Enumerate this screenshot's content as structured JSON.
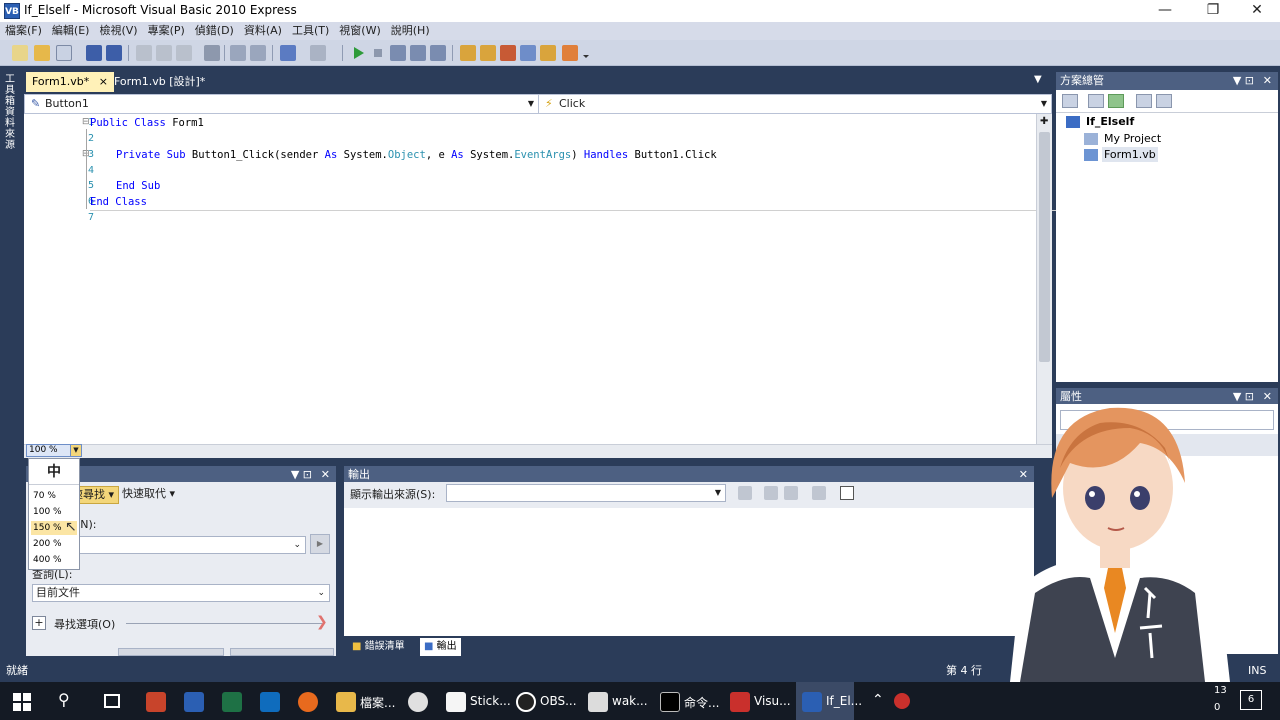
{
  "window": {
    "title": "If_Elself - Microsoft Visual Basic 2010 Express",
    "app_icon_text": "VB"
  },
  "menu": [
    "檔案(F)",
    "編輯(E)",
    "檢視(V)",
    "專案(P)",
    "偵錯(D)",
    "資料(A)",
    "工具(T)",
    "視窗(W)",
    "說明(H)"
  ],
  "left_strip": {
    "label": "工具箱資料來源"
  },
  "doc_tabs": [
    {
      "label": "Form1.vb*",
      "active": true,
      "close": "×"
    },
    {
      "label": "Form1.vb [設計]*",
      "active": false
    }
  ],
  "navbar": {
    "object": "Button1",
    "event": "Click"
  },
  "code": {
    "line_numbers": [
      "1",
      "2",
      "3",
      "4",
      "5",
      "6",
      "7"
    ],
    "lines": [
      "Public Class Form1",
      "",
      "Private Sub Button1_Click(sender As System.Object, e As System.EventArgs) Handles Button1.Click",
      "",
      "End Sub",
      "End Class",
      ""
    ]
  },
  "zoom": {
    "value": "100 %",
    "menu_header": "中",
    "options": [
      "70 %",
      "100 %",
      "150 %",
      "200 %",
      "400 %"
    ],
    "highlighted": "150 %"
  },
  "solution_explorer": {
    "title": "方案總管",
    "items": [
      {
        "label": "If_Elself"
      },
      {
        "label": "My Project"
      },
      {
        "label": "Form1.vb"
      }
    ]
  },
  "properties": {
    "title": "屬性"
  },
  "find_pane": {
    "tab_find": "快速尋找",
    "tab_replace": "快速取代",
    "find_label": "尋找目標(N):",
    "look_in_label": "查詢(L):",
    "look_in_value": "目前文件",
    "options_label": "尋找選項(O)",
    "expand": "+"
  },
  "output_pane": {
    "title": "輸出",
    "source_label": "顯示輸出來源(S):",
    "source_value": ""
  },
  "bottom_tabs": [
    "錯誤清單",
    "輸出"
  ],
  "status": {
    "left": "就緒",
    "line": "第 4 行",
    "ins": "INS"
  },
  "taskbar": {
    "items": [
      "檔案...",
      "Stick...",
      "OBS...",
      "wak...",
      "命令...",
      "Visu...",
      "If_El..."
    ],
    "time": "13",
    "date": "0",
    "notif": "6"
  },
  "colors": {
    "chrome": "#2b3c59",
    "menu": "#d6dbe9",
    "active_tab": "#fff1b8",
    "keyword": "#0000ff",
    "type": "#2b91af"
  }
}
